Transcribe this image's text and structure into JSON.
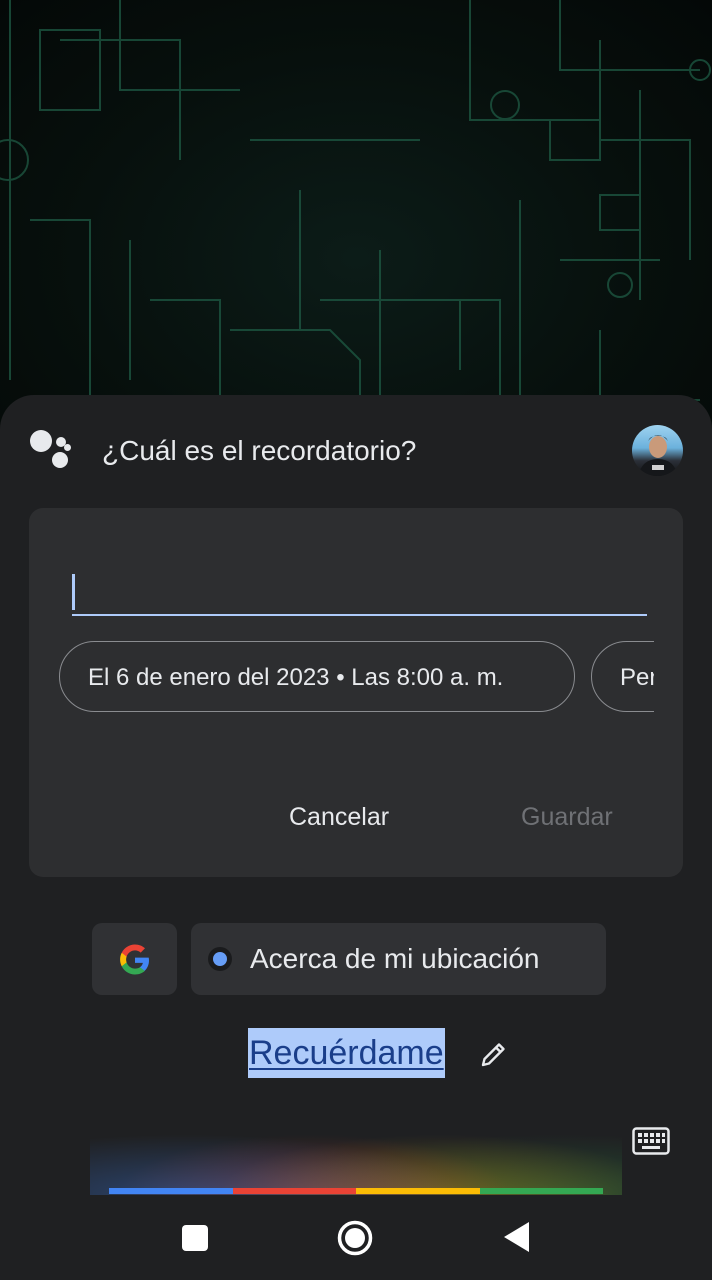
{
  "assistant": {
    "prompt": "¿Cuál es el recordatorio?"
  },
  "reminder_card": {
    "input_value": "",
    "date_chip": "El 6 de enero del 2023 • Las 8:00 a. m.",
    "repeat_chip_partial": "Per",
    "cancel_label": "Cancelar",
    "save_label": "Guardar"
  },
  "suggestions": {
    "location_chip": "Acerca de mi ubicación"
  },
  "query": {
    "text": "Recuérdame"
  },
  "colors": {
    "sheet_bg": "#1f2022",
    "card_bg": "#2d2e30",
    "accent_blue": "#aecbfa",
    "google_blue": "#4285f4",
    "google_red": "#ea4335",
    "google_yellow": "#fbbc05",
    "google_green": "#34a853"
  },
  "icons": [
    "assistant-logo",
    "avatar",
    "google-g-icon",
    "location-dot-icon",
    "edit-pencil-icon",
    "keyboard-icon",
    "recents-nav-icon",
    "home-nav-icon",
    "back-nav-icon"
  ]
}
